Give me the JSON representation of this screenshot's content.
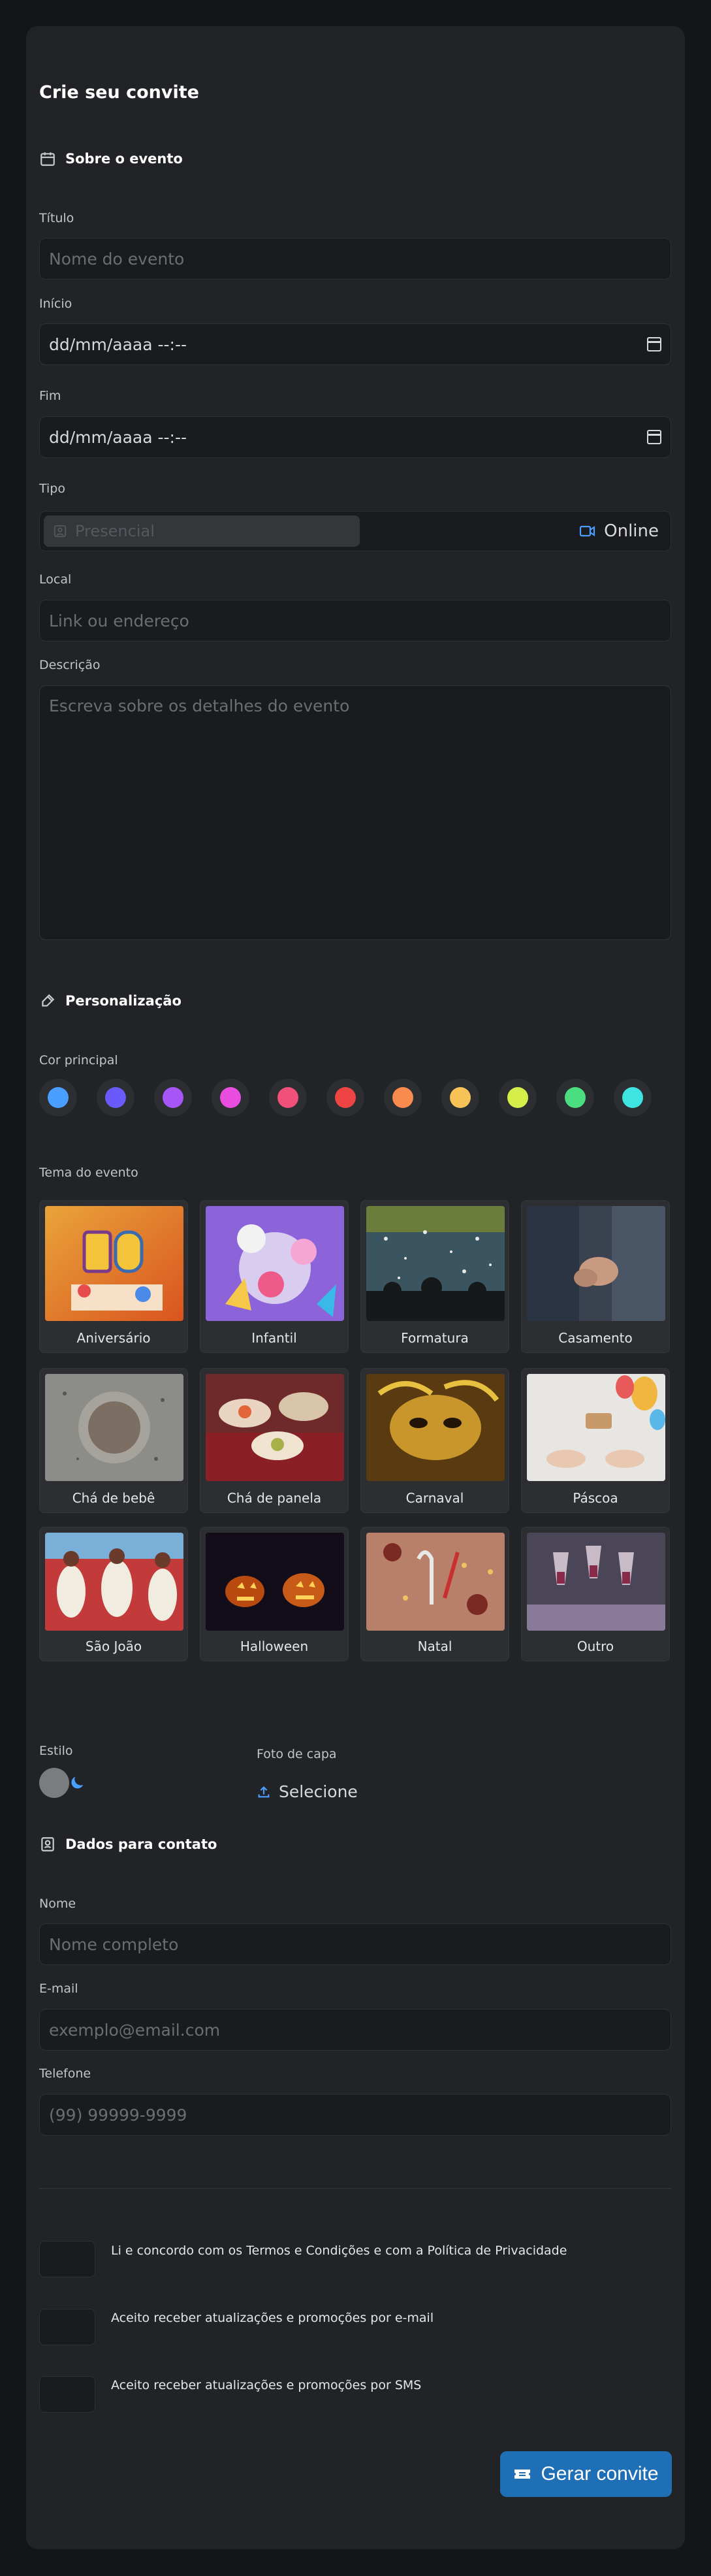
{
  "page": {
    "title": "Crie seu convite"
  },
  "about": {
    "heading": "Sobre o evento",
    "title_label": "Título",
    "title_placeholder": "Nome do evento",
    "start_label": "Início",
    "start_value": "dd/mm/aaaa --:--",
    "end_label": "Fim",
    "end_value": "dd/mm/aaaa --:--",
    "type_label": "Tipo",
    "type_options": [
      "Presencial",
      "Online"
    ],
    "type_selected": "Online",
    "location_label": "Local",
    "location_placeholder": "Link ou endereço",
    "description_label": "Descrição",
    "description_placeholder": "Escreva sobre os detalhes do evento"
  },
  "personalize": {
    "heading": "Personalização",
    "color_label": "Cor principal",
    "colors": [
      "#4a9eff",
      "#6a5af9",
      "#a855f7",
      "#e84de0",
      "#f0507a",
      "#ef4444",
      "#f98b4e",
      "#f8c356",
      "#d6ee4a",
      "#4ade80",
      "#3ee5e0"
    ],
    "theme_label": "Tema do evento",
    "themes": [
      {
        "label": "Aniversário",
        "icon": "birthday-cake-photo"
      },
      {
        "label": "Infantil",
        "icon": "kids-party-photo"
      },
      {
        "label": "Formatura",
        "icon": "graduation-photo"
      },
      {
        "label": "Casamento",
        "icon": "wedding-photo"
      },
      {
        "label": "Chá de bebê",
        "icon": "baby-shower-photo"
      },
      {
        "label": "Chá de panela",
        "icon": "bridal-shower-photo"
      },
      {
        "label": "Carnaval",
        "icon": "carnival-mask-photo"
      },
      {
        "label": "Páscoa",
        "icon": "easter-photo"
      },
      {
        "label": "São João",
        "icon": "festa-junina-photo"
      },
      {
        "label": "Halloween",
        "icon": "pumpkin-photo"
      },
      {
        "label": "Natal",
        "icon": "christmas-photo"
      },
      {
        "label": "Outro",
        "icon": "toast-photo"
      }
    ],
    "style_label": "Estilo",
    "cover_label": "Foto de capa",
    "cover_button": "Selecione"
  },
  "contact": {
    "heading": "Dados para contato",
    "name_label": "Nome",
    "name_placeholder": "Nome completo",
    "email_label": "E-mail",
    "email_placeholder": "exemplo@email.com",
    "phone_label": "Telefone",
    "phone_placeholder": "(99) 99999-9999"
  },
  "consent": {
    "terms": "Li e concordo com os Termos e Condições e com a Política de Privacidade",
    "email_updates": "Aceito receber atualizações e promoções por e-mail",
    "sms_updates": "Aceito receber atualizações e promoções por SMS"
  },
  "actions": {
    "submit": "Gerar convite"
  },
  "theme_colors": {
    "accent": "#1f6fb6",
    "online_icon": "#4a9eff"
  }
}
